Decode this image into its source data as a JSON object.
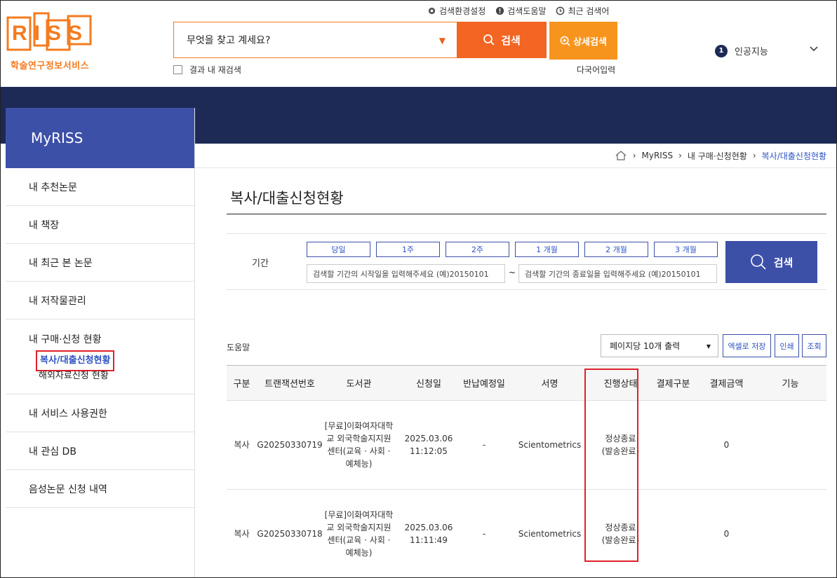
{
  "logo": {
    "text": "RISS",
    "subtitle": "학술연구정보서비스"
  },
  "util_links": [
    "검색환경설정",
    "검색도움말",
    "최근 검색어"
  ],
  "search": {
    "placeholder": "무엇을 찾고 계세요?",
    "button": "검색",
    "advanced": "상세검색",
    "re_search": "결과 내 재검색",
    "multi_lang": "다국어입력"
  },
  "trending": {
    "rank": "1",
    "keyword": "인공지능"
  },
  "sidebar": {
    "title": "MyRISS",
    "items": [
      "내 추천논문",
      "내 책장",
      "내 최근 본 논문",
      "내 저작물관리"
    ],
    "group": {
      "label": "내 구매·신청 현황",
      "subs": [
        "복사/대출신청현황",
        "해외자료신청 현황"
      ]
    },
    "items_after": [
      "내 서비스 사용권한",
      "내 관심 DB",
      "음성논문 신청 내역"
    ]
  },
  "breadcrumb": [
    "MyRISS",
    "내 구매·신청현황",
    "복사/대출신청현황"
  ],
  "page_title": "복사/대출신청현황",
  "period": {
    "label": "기간",
    "buttons": [
      "당일",
      "1주",
      "2주",
      "1 개월",
      "2 개월",
      "3 개월"
    ],
    "start_placeholder": "검색할 기간의 시작일을 입력해주세요 (예)20150101",
    "end_placeholder": "검색할 기간의 종료일을 입력해주세요 (예)20150101",
    "tilde": "~",
    "search": "검색"
  },
  "toolbar": {
    "help": "도움말",
    "per_page": "페이지당 10개 출력",
    "excel": "엑셀로 저장",
    "print": "인쇄",
    "view": "조회"
  },
  "table": {
    "headers": [
      "구분",
      "트랜잭션번호",
      "도서관",
      "신청일",
      "반납예정일",
      "서명",
      "진행상태",
      "결제구분",
      "결제금액",
      "기능"
    ],
    "rows": [
      {
        "type": "복사",
        "tx": "G20250330719",
        "library": "[무료]이화여자대학교 외국학술지지원센터(교육 · 사회 · 예체능)",
        "date": "2025.03.06",
        "time": "11:12:05",
        "return": "-",
        "title": "Scientometrics",
        "status1": "정상종료",
        "status2": "(발송완료)",
        "pay_type": "",
        "amount": "0",
        "func": ""
      },
      {
        "type": "복사",
        "tx": "G20250330718",
        "library": "[무료]이화여자대학교 외국학술지지원센터(교육 · 사회 · 예체능)",
        "date": "2025.03.06",
        "time": "11:11:49",
        "return": "-",
        "title": "Scientometrics",
        "status1": "정상종료",
        "status2": "(발송완료)",
        "pay_type": "",
        "amount": "0",
        "func": ""
      }
    ]
  },
  "colors": {
    "brand": "#f47b20",
    "navy": "#1c2a55",
    "blue": "#3d50a8",
    "highlight": "#e0202a"
  }
}
